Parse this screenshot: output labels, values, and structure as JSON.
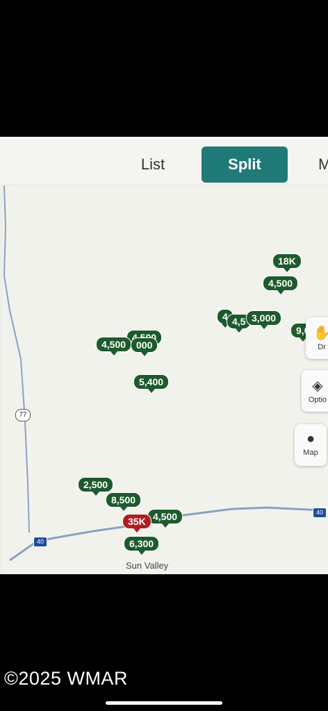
{
  "tabs": {
    "list": "List",
    "split": "Split",
    "map_partial": "M"
  },
  "markers": [
    {
      "label": "18K"
    },
    {
      "label": "4,500"
    },
    {
      "label": "4,500"
    },
    {
      "label": "4,500"
    },
    {
      "label": "000"
    },
    {
      "label": "4,5"
    },
    {
      "label": "4"
    },
    {
      "label": "3,000"
    },
    {
      "label": "9,0"
    },
    {
      "label": "5,400"
    },
    {
      "label": "2,500"
    },
    {
      "label": "8,500"
    },
    {
      "label": "4,500"
    },
    {
      "label": "35K"
    },
    {
      "label": "6,300"
    }
  ],
  "side_buttons": {
    "draw": "Dr",
    "options": "Optio",
    "map": "Map"
  },
  "roads": {
    "highway_77": "77",
    "interstate_40_left": "40",
    "interstate_40_right": "40"
  },
  "place_label": "Sun Valley",
  "watermark": "©2025  WMAR",
  "colors": {
    "accent": "#1f7a78",
    "marker": "#1d5a2c",
    "marker_highlight": "#b01e24"
  }
}
